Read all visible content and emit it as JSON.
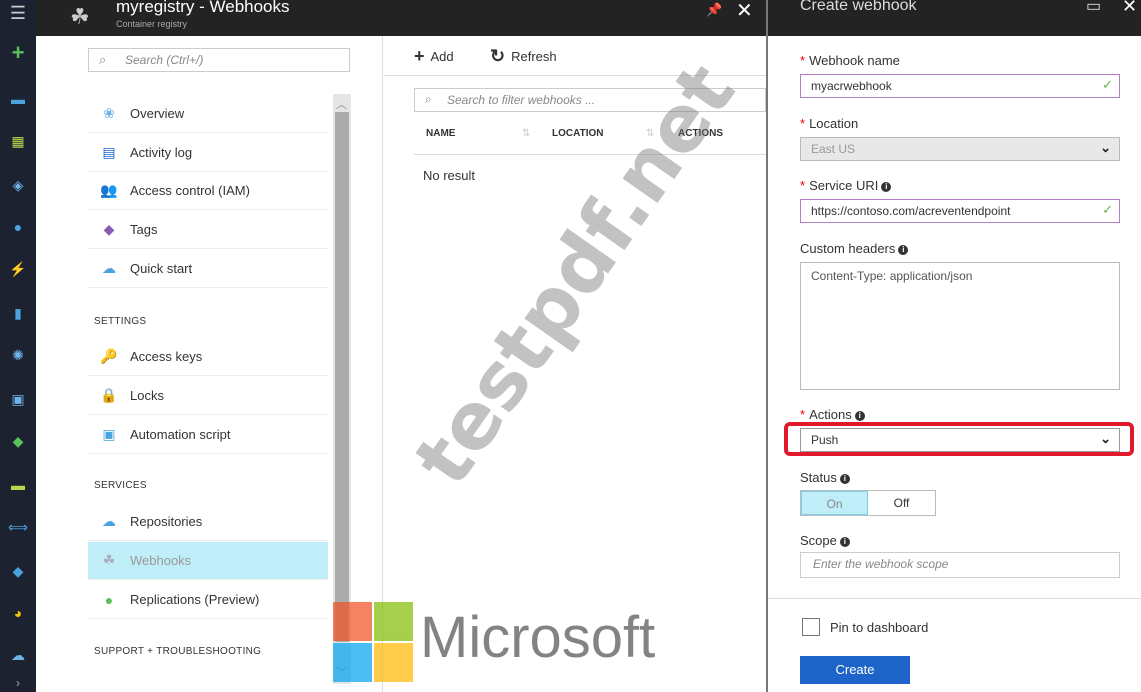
{
  "topbar": {
    "title": "myregistry - Webhooks",
    "subtitle": "Container registry"
  },
  "menu": {
    "search_placeholder": "Search (Ctrl+/)",
    "items": [
      {
        "label": "Overview",
        "icon": "overview-icon"
      },
      {
        "label": "Activity log",
        "icon": "activity-log-icon"
      },
      {
        "label": "Access control (IAM)",
        "icon": "iam-icon"
      },
      {
        "label": "Tags",
        "icon": "tag-icon"
      },
      {
        "label": "Quick start",
        "icon": "quick-start-icon"
      }
    ],
    "settings_header": "SETTINGS",
    "settings_items": [
      {
        "label": "Access keys",
        "icon": "key-icon"
      },
      {
        "label": "Locks",
        "icon": "lock-icon"
      },
      {
        "label": "Automation script",
        "icon": "automation-icon"
      }
    ],
    "services_header": "SERVICES",
    "services_items": [
      {
        "label": "Repositories",
        "icon": "repositories-icon"
      },
      {
        "label": "Webhooks",
        "icon": "webhooks-icon",
        "selected": true
      },
      {
        "label": "Replications (Preview)",
        "icon": "replications-icon"
      }
    ],
    "support_header": "SUPPORT + TROUBLESHOOTING"
  },
  "list": {
    "add_label": "Add",
    "refresh_label": "Refresh",
    "filter_placeholder": "Search to filter webhooks ...",
    "columns": [
      "NAME",
      "LOCATION",
      "ACTIONS"
    ],
    "empty_text": "No result"
  },
  "create": {
    "title": "Create webhook",
    "webhook_name_label": "Webhook name",
    "webhook_name_value": "myacrwebhook",
    "location_label": "Location",
    "location_value": "East US",
    "service_uri_label": "Service URI",
    "service_uri_value": "https://contoso.com/acreventendpoint",
    "custom_headers_label": "Custom headers",
    "custom_headers_value": "Content-Type: application/json",
    "actions_label": "Actions",
    "actions_value": "Push",
    "status_label": "Status",
    "status_on": "On",
    "status_off": "Off",
    "status_selected": "On",
    "scope_label": "Scope",
    "scope_placeholder": "Enter the webhook scope",
    "pin_label": "Pin to dashboard",
    "create_label": "Create"
  },
  "watermark": {
    "text": "testpdf.net",
    "brand": "Microsoft"
  },
  "colors": {
    "highlight": "#e01a2a",
    "primary_button": "#1e64c8",
    "selected_bg": "#bfeef8"
  }
}
